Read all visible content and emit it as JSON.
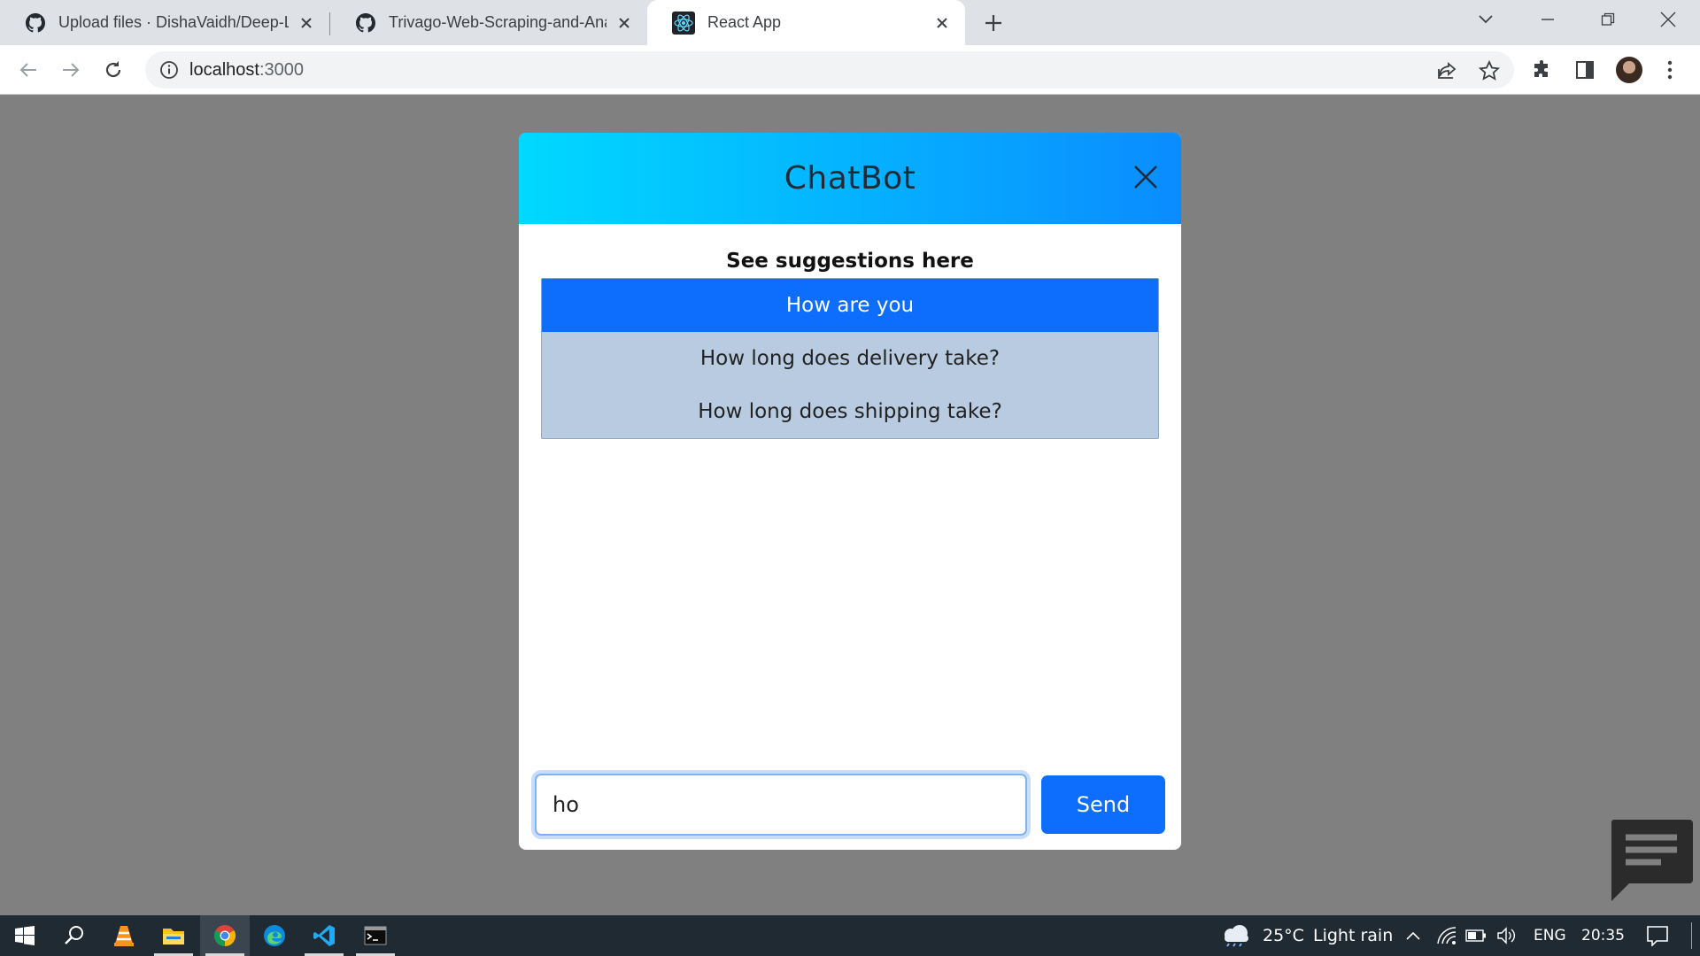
{
  "browser": {
    "tabs": [
      {
        "title": "Upload files · DishaVaidh/Deep-Le",
        "icon": "github-icon"
      },
      {
        "title": "Trivago-Web-Scraping-and-Analy",
        "icon": "github-icon"
      },
      {
        "title": "React App",
        "icon": "react-icon",
        "active": true
      }
    ],
    "url_host": "localhost",
    "url_port": ":3000"
  },
  "chatbot": {
    "title": "ChatBot",
    "suggestions_heading": "See suggestions here",
    "suggestions": [
      {
        "label": "How are you",
        "active": true
      },
      {
        "label": "How long does delivery take?"
      },
      {
        "label": "How long does shipping take?"
      }
    ],
    "input_value": "ho",
    "send_label": "Send"
  },
  "taskbar": {
    "weather_temp": "25°C",
    "weather_text": "Light rain",
    "language": "ENG",
    "time": "20:35"
  },
  "colors": {
    "header_gradient_start": "#00d9ff",
    "header_gradient_end": "#0a8cff",
    "primary": "#0d6efd",
    "suggestion_bg": "#b8cbe0",
    "overlay": "#808080"
  }
}
